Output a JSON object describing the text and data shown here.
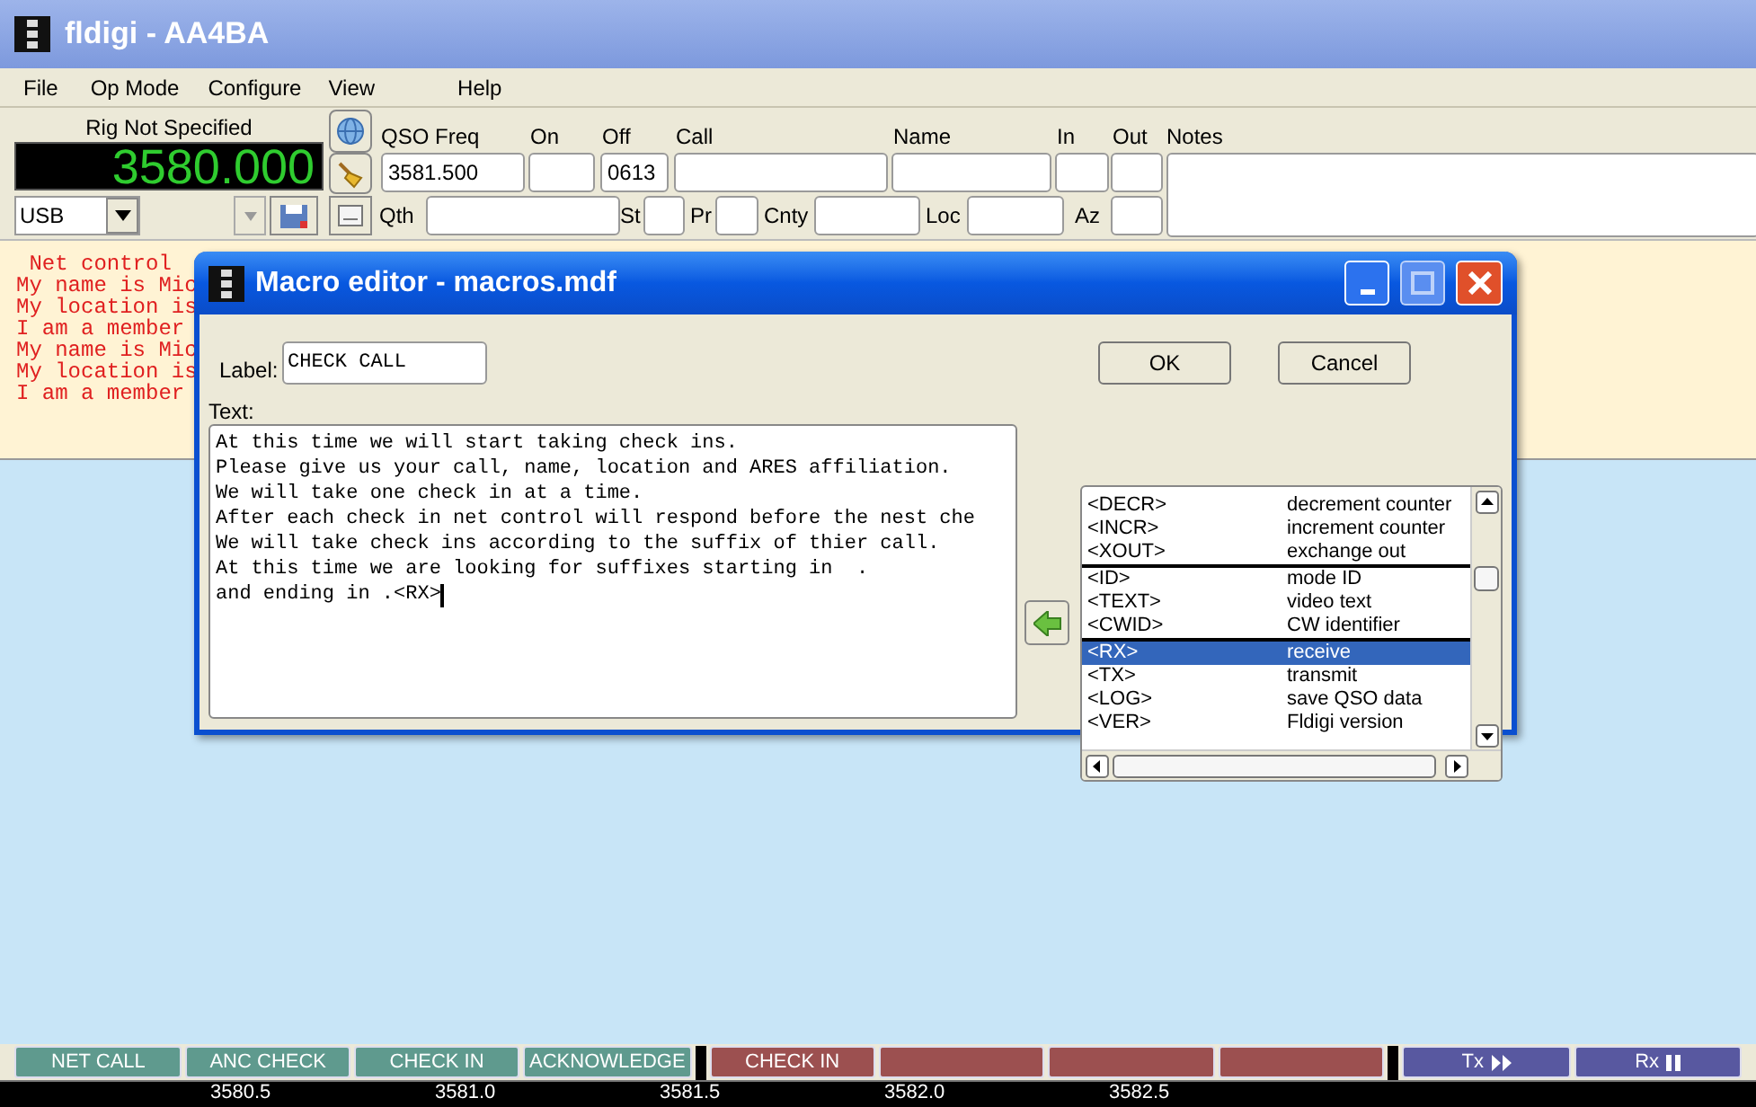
{
  "window": {
    "title": "fldigi - AA4BA"
  },
  "menu": [
    {
      "label": "File"
    },
    {
      "label": "Op Mode"
    },
    {
      "label": "Configure"
    },
    {
      "label": "View"
    },
    {
      "label": "Help"
    }
  ],
  "rig": {
    "label": "Rig Not Specified",
    "frequency": "3580.000",
    "mode": "USB"
  },
  "log_fields_top": [
    {
      "label": "QSO Freq",
      "value": "3581.500"
    },
    {
      "label": "On"
    },
    {
      "label": "Off",
      "value": "0613"
    },
    {
      "label": "Call"
    },
    {
      "label": "Name"
    },
    {
      "label": "In"
    },
    {
      "label": "Out"
    }
  ],
  "notes_label": "Notes",
  "log_fields_bottom": [
    {
      "label": "Qth"
    },
    {
      "label": "St"
    },
    {
      "label": "Pr"
    },
    {
      "label": "Cnty"
    },
    {
      "label": "Loc"
    },
    {
      "label": "Az"
    }
  ],
  "rx_text": [
    " Net control",
    "My name is Mic",
    "My location is",
    "I am a member",
    "My name is Mic",
    "My location is",
    "I am a member"
  ],
  "macro_editor": {
    "title": "Macro editor - macros.mdf",
    "label_caption": "Label:",
    "label_value": "CHECK CALL",
    "text_caption": "Text:",
    "text_lines": [
      "At this time we will start taking check ins.",
      "Please give us your call, name, location and ARES affiliation.",
      "We will take one check in at a time.",
      "After each check in net control will respond before the nest che",
      "We will take check ins according to the suffix of thier call.",
      "At this time we are looking for suffixes starting in  .",
      "and ending in .<RX>"
    ],
    "buttons": [
      "OK",
      "Cancel"
    ],
    "macros": [
      {
        "tag": "<DECR>",
        "description": "decrement counter",
        "selected": false,
        "separator_before": false
      },
      {
        "tag": "<INCR>",
        "description": "increment counter",
        "selected": false,
        "separator_before": false
      },
      {
        "tag": "<XOUT>",
        "description": "exchange out",
        "selected": false,
        "separator_before": false
      },
      {
        "tag": "<ID>",
        "description": "mode ID",
        "selected": false,
        "separator_before": true
      },
      {
        "tag": "<TEXT>",
        "description": "video text",
        "selected": false,
        "separator_before": false
      },
      {
        "tag": "<CWID>",
        "description": "CW identifier",
        "selected": false,
        "separator_before": false
      },
      {
        "tag": "<RX>",
        "description": "receive",
        "selected": true,
        "separator_before": true
      },
      {
        "tag": "<TX>",
        "description": "transmit",
        "selected": false,
        "separator_before": false
      },
      {
        "tag": "<LOG>",
        "description": "save QSO data",
        "selected": false,
        "separator_before": false
      },
      {
        "tag": "<VER>",
        "description": "Fldigi version",
        "selected": false,
        "separator_before": false
      }
    ]
  },
  "macro_bar": [
    {
      "label": "NET CALL",
      "color": "#5f9a8e"
    },
    {
      "label": "ANC CHECK",
      "color": "#5f9a8e"
    },
    {
      "label": "CHECK IN",
      "color": "#5f9a8e"
    },
    {
      "label": "ACKNOWLEDGE",
      "color": "#5f9a8e"
    },
    {
      "kind": "gap"
    },
    {
      "label": "CHECK IN",
      "color": "#9c5050"
    },
    {
      "color": "#9c5050"
    },
    {
      "color": "#9c5050"
    },
    {
      "color": "#9c5050"
    },
    {
      "kind": "gap"
    },
    {
      "label": "Tx",
      "color": "#5858a0",
      "kind": "transmit"
    },
    {
      "label": "Rx",
      "color": "#5858a0",
      "kind": "receive"
    }
  ],
  "waterfall_scale": [
    "3580.5",
    "3581.0",
    "3581.5",
    "3582.0",
    "3582.5"
  ]
}
